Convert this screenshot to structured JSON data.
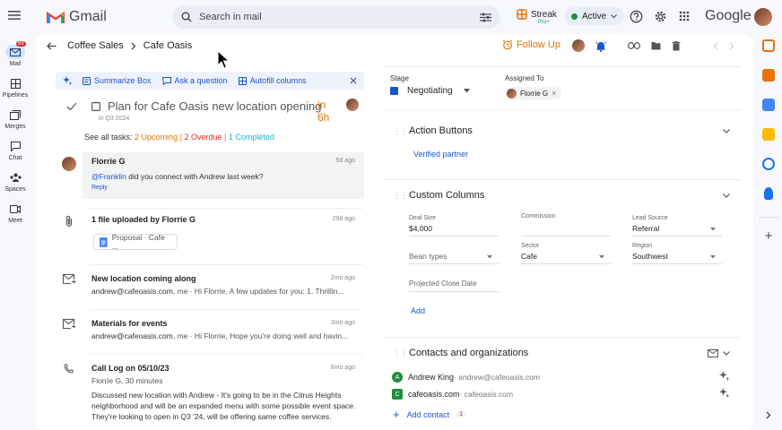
{
  "app": {
    "name": "Gmail"
  },
  "search": {
    "placeholder": "Search in mail"
  },
  "streak": {
    "label": "Streak",
    "tier": "Pro+"
  },
  "status": {
    "label": "Active"
  },
  "brand": {
    "google": "Google"
  },
  "rail": {
    "items": [
      {
        "label": "Mail",
        "badge": "69"
      },
      {
        "label": "Pipelines"
      },
      {
        "label": "Merges"
      },
      {
        "label": "Chat"
      },
      {
        "label": "Spaces"
      },
      {
        "label": "Meet"
      }
    ]
  },
  "breadcrumb": {
    "pipeline": "Coffee Sales",
    "box": "Cafe Oasis"
  },
  "header": {
    "follow_up": "Follow Up"
  },
  "ai_bar": {
    "summarize": "Summarize Box",
    "ask": "Ask a question",
    "autofill": "Autofill columns"
  },
  "task": {
    "title": "Plan for Cafe Oasis new location opening",
    "due": "in 6h",
    "date": "in Q3 2024"
  },
  "tasks_summary": {
    "prefix": "See all tasks:",
    "upcoming": "2 Upcoming",
    "overdue": "2 Overdue",
    "completed": "1 Completed"
  },
  "feed": [
    {
      "title": "Florrie G",
      "date": "5d ago",
      "mention": "@Franklin",
      "body": " did you connect with Andrew last week?",
      "reply": "Reply"
    },
    {
      "title": "1 file uploaded by Florrie G",
      "date": "29d ago",
      "file": "Proposal · Cafe ..."
    },
    {
      "title": "New location coming along",
      "date": "2mo ago",
      "sender": "andrew@cafeoasis.com",
      "snippet": ", me · Hi Florrie, A few updates for you: 1. Thrillin..."
    },
    {
      "title": "Materials for events",
      "date": "3mo ago",
      "sender": "andrew@cafeoasis.com",
      "snippet": ", me · Hi Florrie, Hope you're doing well and havin..."
    },
    {
      "title": "Call Log on 05/10/23",
      "date": "6mo ago",
      "subtitle": "Florrie G, 30 minutes",
      "lines": [
        "Discussed new location with Andrew - It's going to be in the Citrus Heights",
        "neighborhood and will be an expanded menu with some possible event space.",
        "They're looking to open in Q3 '24, will be offering same coffee services."
      ]
    }
  ],
  "stage": {
    "label": "Stage",
    "value": "Negotiating"
  },
  "assigned": {
    "label": "Assigned To",
    "value": "Florrie G"
  },
  "action_buttons": {
    "title": "Action Buttons",
    "button": "Verified partner"
  },
  "custom_columns": {
    "title": "Custom Columns",
    "deal_size": {
      "label": "Deal Size",
      "value": "$4,000"
    },
    "commission": {
      "label": "Commission",
      "value": ""
    },
    "lead_source": {
      "label": "Lead Source",
      "value": "Referral"
    },
    "bean_types": {
      "placeholder": "Bean types"
    },
    "sector": {
      "label": "Sector",
      "value": "Cafe"
    },
    "region": {
      "label": "Region",
      "value": "Southwest"
    },
    "close_date": {
      "placeholder": "Projected Close Date"
    },
    "add": "Add"
  },
  "contacts": {
    "title": "Contacts and organizations",
    "items": [
      {
        "initial": "A",
        "name": "Andrew King",
        "email": " · andrew@cafeoasis.com",
        "color": "#1e8e3e"
      },
      {
        "initial": "C",
        "name": "cafeoasis.com",
        "email": " · cafeoasis.com",
        "color": "#1e8e3e"
      }
    ],
    "add_label": "Add contact",
    "count": "1"
  },
  "colors": {
    "accent": "#1a56c9",
    "orange": "#e37400",
    "red": "#d93025",
    "teal": "#12b5cb"
  }
}
